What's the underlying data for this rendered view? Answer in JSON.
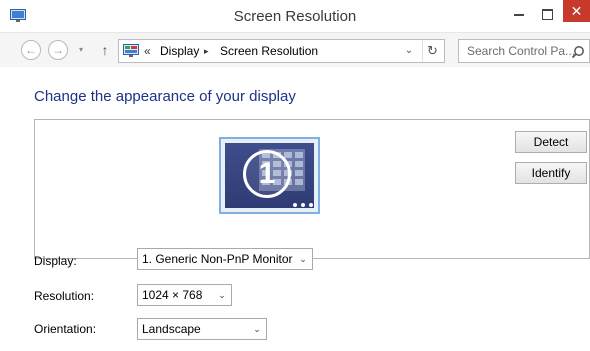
{
  "window": {
    "title": "Screen Resolution",
    "close_glyph": "✕"
  },
  "nav": {
    "back_glyph": "←",
    "forward_glyph": "→",
    "recent_glyph": "▾",
    "up_glyph": "↑",
    "address": {
      "overflow": "«",
      "crumbs": [
        "Display",
        "Screen Resolution"
      ],
      "separator": "▸",
      "dropdown_glyph": "⌄",
      "refresh_glyph": "↻"
    },
    "search_placeholder": "Search Control Pa..."
  },
  "main": {
    "heading": "Change the appearance of your display",
    "monitor": {
      "number": "1"
    },
    "buttons": {
      "detect": "Detect",
      "identify": "Identify"
    },
    "settings": {
      "display_label": "Display:",
      "display_value": "1. Generic Non-PnP Monitor",
      "resolution_label": "Resolution:",
      "resolution_value": "1024 × 768",
      "orientation_label": "Orientation:",
      "orientation_value": "Landscape"
    },
    "dropdown_glyph": "⌄"
  },
  "colors": {
    "heading": "#1e3287",
    "close": "#c7392b",
    "monitor_screen": "#3e4e8c",
    "monitor_frame": "#7fb0e0"
  }
}
